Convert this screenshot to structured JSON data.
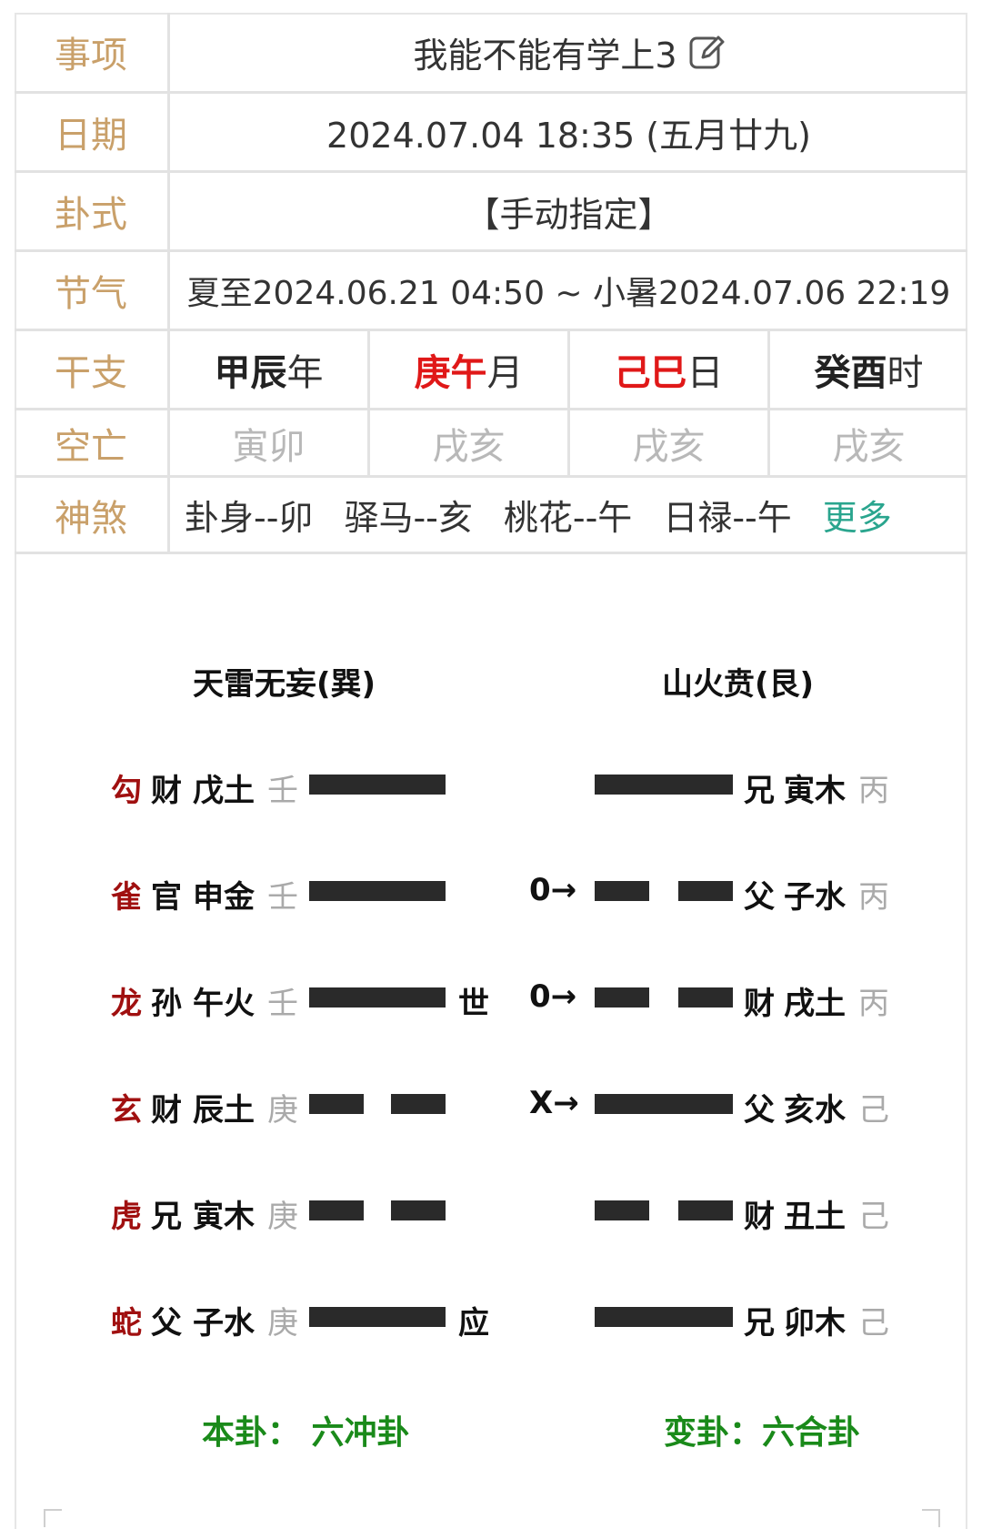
{
  "info": {
    "shixiang": {
      "label": "事项",
      "value": "我能不能有学上3"
    },
    "riqi": {
      "label": "日期",
      "value": "2024.07.04 18:35 (五月廿九)"
    },
    "guashi": {
      "label": "卦式",
      "value": "【手动指定】"
    },
    "jieqi": {
      "label": "节气",
      "value": "夏至2024.06.21 04:50 ~ 小暑2024.07.06 22:19"
    },
    "ganzhi": {
      "label": "干支",
      "items": [
        {
          "gz": "甲辰",
          "unit": "年"
        },
        {
          "gz": "庚午",
          "unit": "月"
        },
        {
          "gz": "己巳",
          "unit": "日"
        },
        {
          "gz": "癸酉",
          "unit": "时"
        }
      ]
    },
    "kongwang": {
      "label": "空亡",
      "items": [
        "寅卯",
        "戌亥",
        "戌亥",
        "戌亥"
      ]
    },
    "shensha": {
      "label": "神煞",
      "items": [
        "卦身--卯",
        "驿马--亥",
        "桃花--午",
        "日禄--午"
      ],
      "more": "更多"
    }
  },
  "hexagram": {
    "ben_title": "天雷无妄(巽)",
    "bian_title": "山火贲(艮)",
    "lines": [
      {
        "god": "勾",
        "rel": "财",
        "branch": "戊土",
        "stem": "壬",
        "yang": true,
        "mark": "",
        "change": "",
        "b_yang": true,
        "b_rel": "兄",
        "b_branch": "寅木",
        "b_stem": "丙"
      },
      {
        "god": "雀",
        "rel": "官",
        "branch": "申金",
        "stem": "壬",
        "yang": true,
        "mark": "",
        "change": "0→",
        "b_yang": false,
        "b_rel": "父",
        "b_branch": "子水",
        "b_stem": "丙"
      },
      {
        "god": "龙",
        "rel": "孙",
        "branch": "午火",
        "stem": "壬",
        "yang": true,
        "mark": "世",
        "change": "0→",
        "b_yang": false,
        "b_rel": "财",
        "b_branch": "戌土",
        "b_stem": "丙"
      },
      {
        "god": "玄",
        "rel": "财",
        "branch": "辰土",
        "stem": "庚",
        "yang": false,
        "mark": "",
        "change": "X→",
        "b_yang": true,
        "b_rel": "父",
        "b_branch": "亥水",
        "b_stem": "己"
      },
      {
        "god": "虎",
        "rel": "兄",
        "branch": "寅木",
        "stem": "庚",
        "yang": false,
        "mark": "",
        "change": "",
        "b_yang": false,
        "b_rel": "财",
        "b_branch": "丑土",
        "b_stem": "己"
      },
      {
        "god": "蛇",
        "rel": "父",
        "branch": "子水",
        "stem": "庚",
        "yang": true,
        "mark": "应",
        "change": "",
        "b_yang": true,
        "b_rel": "兄",
        "b_branch": "卯木",
        "b_stem": "己"
      }
    ],
    "ben_type": "本卦： 六冲卦",
    "bian_type": "变卦：六合卦"
  },
  "colors": {
    "label": "#c9a06a",
    "red": "#e01818",
    "god": "#a01010",
    "green": "#1a8a1a",
    "more": "#2aa58e"
  }
}
